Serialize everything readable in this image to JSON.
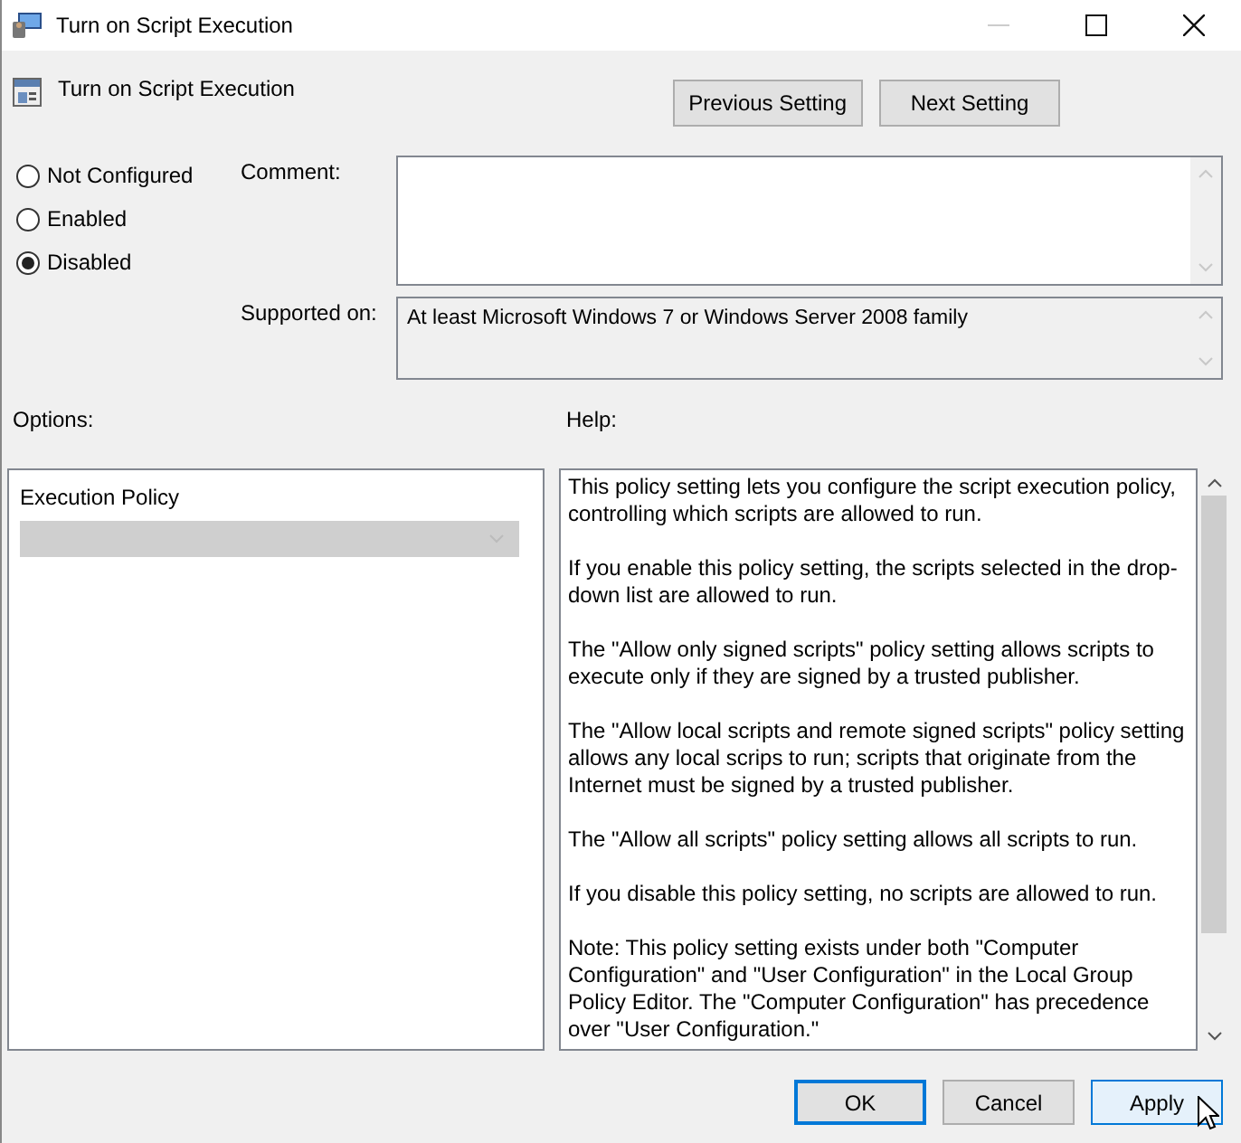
{
  "window": {
    "title": "Turn on Script Execution"
  },
  "policy": {
    "name": "Turn on Script Execution"
  },
  "nav_buttons": [
    {
      "label": "Previous Setting"
    },
    {
      "label": "Next Setting"
    }
  ],
  "states": [
    {
      "label": "Not Configured",
      "selected": false
    },
    {
      "label": "Enabled",
      "selected": false
    },
    {
      "label": "Disabled",
      "selected": true
    }
  ],
  "comment": {
    "label": "Comment:"
  },
  "supported_on": {
    "label": "Supported on:",
    "value": "At least Microsoft Windows 7 or Windows Server 2008 family"
  },
  "options": {
    "label": "Options:",
    "fields": [
      {
        "label": "Execution Policy",
        "disabled": true
      }
    ]
  },
  "help": {
    "label": "Help:",
    "paragraphs": [
      "This policy setting lets you configure the script execution policy, controlling which scripts are allowed to run.",
      "If you enable this policy setting, the scripts selected in the drop-down list are allowed to run.",
      "The \"Allow only signed scripts\" policy setting allows scripts to execute only if they are signed by a trusted publisher.",
      "The \"Allow local scripts and remote signed scripts\" policy setting allows any local scrips to run; scripts that originate from the Internet must be signed by a trusted publisher.",
      "The \"Allow all scripts\" policy setting allows all scripts to run.",
      "If you disable this policy setting, no scripts are allowed to run.",
      "Note: This policy setting exists under both \"Computer Configuration\" and \"User Configuration\" in the Local Group Policy Editor. The \"Computer Configuration\" has precedence over \"User Configuration.\""
    ]
  },
  "buttons": [
    {
      "label": "OK",
      "focused": true,
      "hovered": false
    },
    {
      "label": "Cancel",
      "focused": false,
      "hovered": false
    },
    {
      "label": "Apply",
      "focused": false,
      "hovered": true
    }
  ]
}
